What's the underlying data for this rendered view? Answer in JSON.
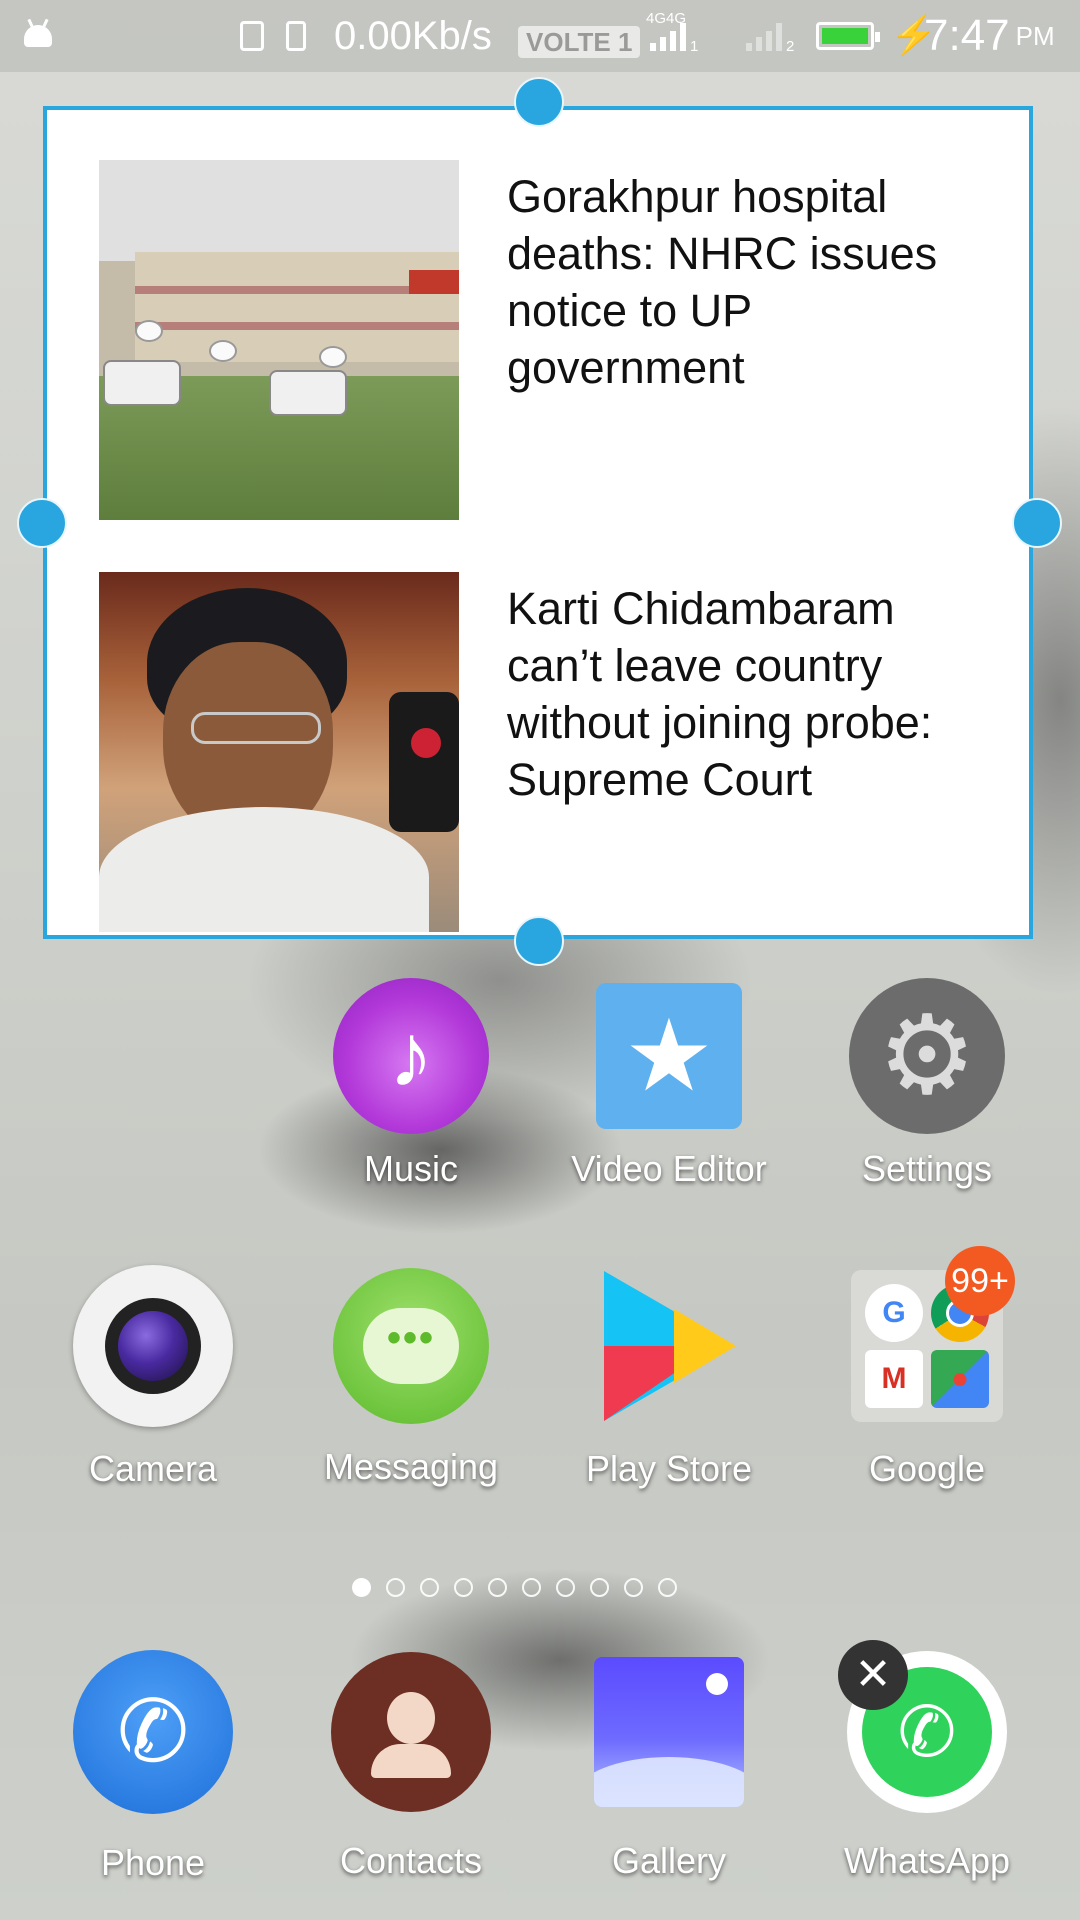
{
  "status_bar": {
    "speed": "0.00Kb/s",
    "volte": "VOLTE 1",
    "network_1": "4G",
    "network_2": "4G",
    "sim_1": "1",
    "sim_2": "2",
    "time": "7:47",
    "ampm": "PM",
    "battery_color": "#39d23b"
  },
  "widget": {
    "border_color": "#2aa6de",
    "news": [
      {
        "title": "Gorakhpur hospital deaths: NHRC issues notice to UP government"
      },
      {
        "title": "Karti Chidambaram can’t leave country without joining probe: Supreme Court"
      }
    ]
  },
  "apps": {
    "row1": [
      {
        "label": "Music",
        "icon": "music-icon"
      },
      {
        "label": "Video Editor",
        "icon": "video-editor-icon"
      },
      {
        "label": "Settings",
        "icon": "settings-gear-icon"
      }
    ],
    "row2": [
      {
        "label": "Camera",
        "icon": "camera-icon"
      },
      {
        "label": "Messaging",
        "icon": "messaging-icon"
      },
      {
        "label": "Play Store",
        "icon": "play-store-icon"
      },
      {
        "label": "Google",
        "icon": "google-folder-icon",
        "badge": "99+"
      }
    ],
    "dock": [
      {
        "label": "Phone",
        "icon": "phone-icon"
      },
      {
        "label": "Contacts",
        "icon": "contacts-icon"
      },
      {
        "label": "Gallery",
        "icon": "gallery-icon"
      },
      {
        "label": "WhatsApp",
        "icon": "whatsapp-icon"
      }
    ]
  },
  "page_indicator": {
    "count": 10,
    "active": 0
  },
  "close_symbol": "✕"
}
